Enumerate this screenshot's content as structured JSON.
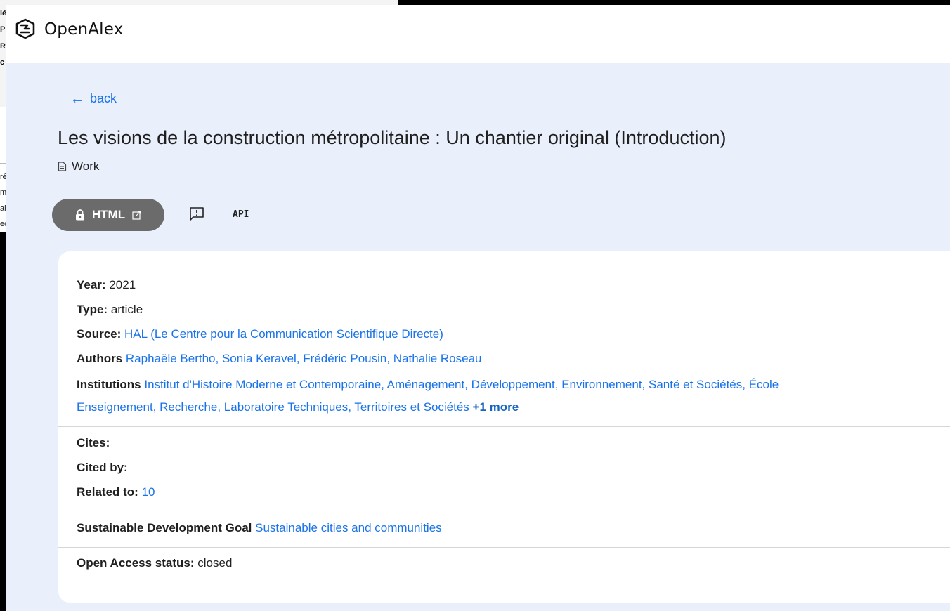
{
  "background_window": {
    "fragments_top": [
      "ié",
      "P",
      "R",
      "c"
    ],
    "fragments_bottom": [
      "ré",
      "m",
      "ai",
      "ec"
    ]
  },
  "header": {
    "app_name": "OpenAlex"
  },
  "nav": {
    "back_label": "back",
    "back_arrow": "←"
  },
  "work": {
    "title": "Les visions de la construction métropolitaine : Un chantier original (Introduction)",
    "entity_type": "Work"
  },
  "actions": {
    "html_label": "HTML",
    "api_label": "API"
  },
  "details": {
    "year_label": "Year:",
    "year": "2021",
    "type_label": "Type:",
    "type": "article",
    "source_label": "Source:",
    "source": "HAL (Le Centre pour la Communication Scientifique Directe)",
    "authors_label": "Authors",
    "authors": [
      "Raphaële Bertho,",
      "Sonia Keravel,",
      "Frédéric Pousin,",
      "Nathalie Roseau"
    ],
    "institutions_label": "Institutions",
    "institutions_line1": [
      "Institut d'Histoire Moderne et Contemporaine,",
      "Aménagement, Développement, Environnement, Santé et Sociétés,",
      "École"
    ],
    "institutions_line2": [
      "Enseignement, Recherche,",
      "Laboratoire Techniques, Territoires et Sociétés"
    ],
    "institutions_more": "+1 more",
    "cites_label": "Cites:",
    "cited_by_label": "Cited by:",
    "related_label": "Related to:",
    "related_count": "10",
    "sdg_label": "Sustainable Development Goal",
    "sdg": "Sustainable cities and communities",
    "oa_label": "Open Access status:",
    "oa_status": "closed"
  },
  "colors": {
    "link": "#1a73e8",
    "content_bg": "#e9f0fb",
    "button_bg": "#6b6b6b"
  }
}
